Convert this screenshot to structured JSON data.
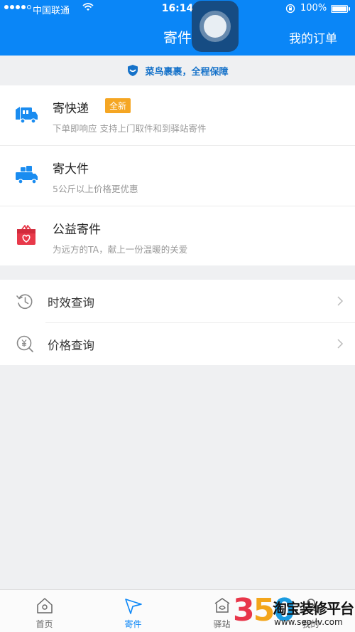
{
  "status_bar": {
    "carrier": "中国联通",
    "time": "16:14",
    "battery": "100%",
    "signal_strength": 4
  },
  "header": {
    "title": "寄件",
    "my_orders": "我的订单"
  },
  "guarantee": {
    "text": "菜鸟裹裹，全程保障",
    "icon": "shield-icon",
    "color": "#1672c9"
  },
  "services": [
    {
      "name": "寄快递",
      "badge": "全新",
      "desc": "下单即响应 支持上门取件和到驿站寄件",
      "icon": "delivery-truck-icon"
    },
    {
      "name": "寄大件",
      "desc": "5公斤以上价格更优惠",
      "icon": "large-cargo-truck-icon"
    },
    {
      "name": "公益寄件",
      "desc": "为远方的TA，献上一份温暖的关爱",
      "icon": "gift-box-heart-icon"
    }
  ],
  "queries": [
    {
      "label": "时效查询",
      "icon": "clock-history-icon"
    },
    {
      "label": "价格查询",
      "icon": "price-search-icon"
    }
  ],
  "tabs": [
    {
      "label": "首页",
      "icon": "home-icon"
    },
    {
      "label": "寄件",
      "icon": "paper-plane-icon",
      "active": true
    },
    {
      "label": "驿站",
      "icon": "station-icon"
    },
    {
      "label": "我的",
      "icon": "user-icon"
    }
  ],
  "watermark": {
    "digits": [
      "3",
      "5",
      "0"
    ],
    "text": "淘宝装修平台",
    "url": "www.seo-lv.com"
  },
  "colors": {
    "brand_blue": "#0a86f7",
    "badge_orange": "#f5a623",
    "icon_red": "#e8394a",
    "background": "#eff0f2"
  }
}
